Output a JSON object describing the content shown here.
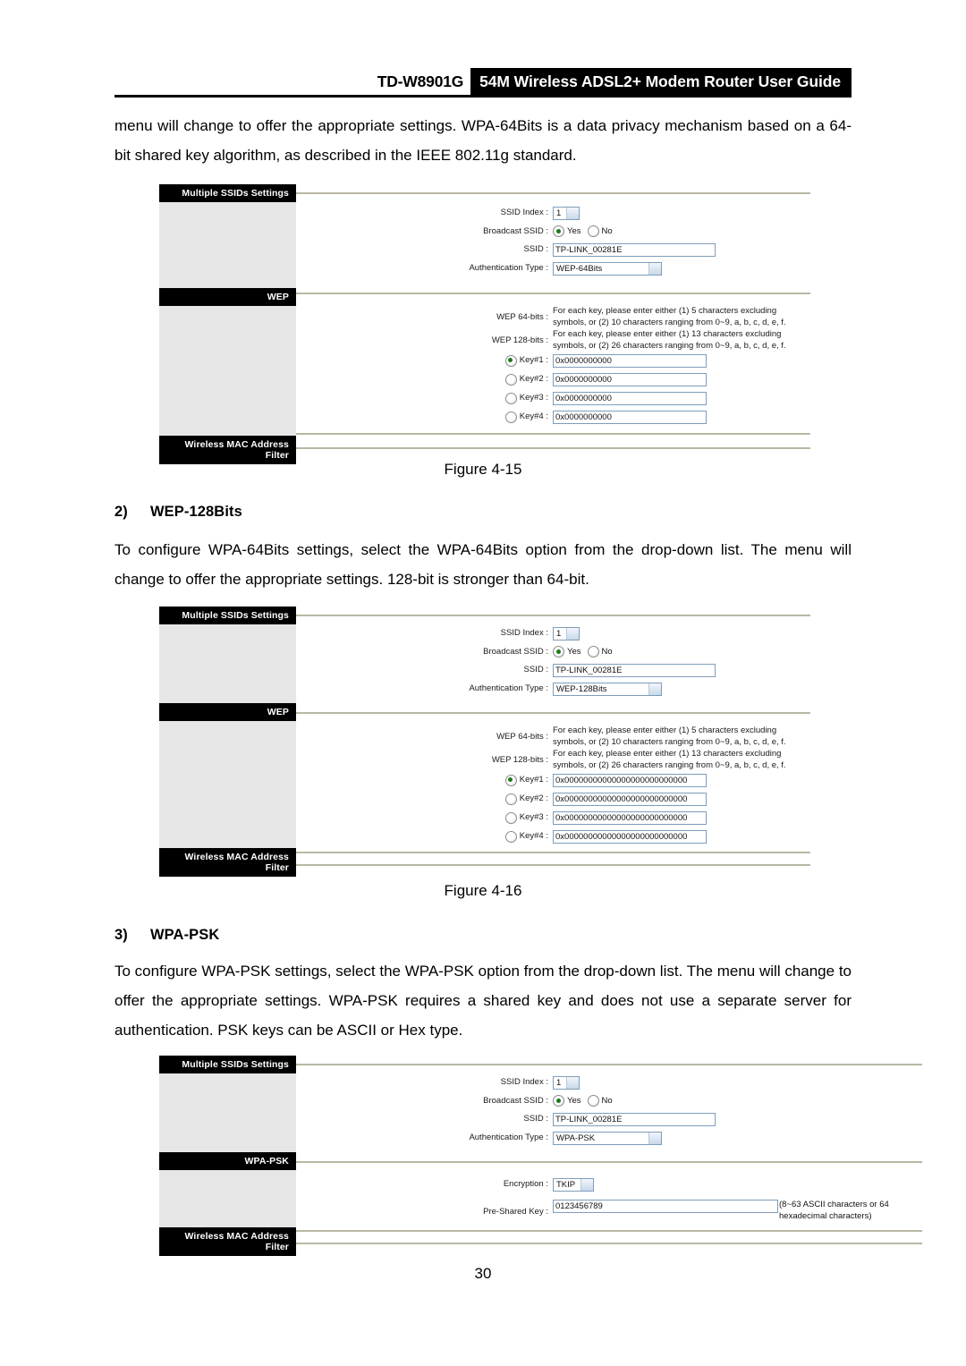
{
  "header": {
    "model": "TD-W8901G",
    "title": "54M Wireless ADSL2+ Modem Router User Guide"
  },
  "body": {
    "intro_paragraph": "menu will change to offer the appropriate settings. WPA-64Bits is a data privacy mechanism based on a 64-bit shared key algorithm, as described in the IEEE 802.11g standard.",
    "figure_4_15_caption": "Figure 4-15",
    "section2": {
      "number": "2)",
      "title": "WEP-128Bits",
      "paragraph": "To configure WPA-64Bits settings, select the WPA-64Bits option from the drop-down list. The menu will change to offer the appropriate settings. 128-bit is stronger than 64-bit."
    },
    "figure_4_16_caption": "Figure 4-16",
    "section3": {
      "number": "3)",
      "title": "WPA-PSK",
      "paragraph": "To configure WPA-PSK settings, select the WPA-PSK option from the drop-down list. The menu will change to offer the appropriate settings. WPA-PSK requires a shared key and does not use a separate server for authentication. PSK keys can be ASCII or Hex type."
    },
    "page_number": "30"
  },
  "shared": {
    "tabs": {
      "multiple_ssids": "Multiple SSIDs Settings",
      "wep": "WEP",
      "wpa_psk": "WPA-PSK",
      "wireless_mac_line1": "Wireless MAC Address",
      "wireless_mac_line2": "Filter"
    },
    "labels": {
      "ssid_index": "SSID Index :",
      "broadcast_ssid": "Broadcast SSID :",
      "ssid": "SSID :",
      "auth_type": "Authentication Type :",
      "wep_64": "WEP 64-bits :",
      "wep_128": "WEP 128-bits :",
      "key1": "Key#1 :",
      "key2": "Key#2 :",
      "key3": "Key#3 :",
      "key4": "Key#4 :",
      "encryption": "Encryption :",
      "pre_shared_key": "Pre-Shared Key :"
    },
    "radio_yes": "Yes",
    "radio_no": "No",
    "hints": {
      "wep_64_hint": "For each key, please enter either (1) 5 characters excluding symbols, or (2) 10 characters ranging from 0~9, a, b, c, d, e, f.",
      "wep_128_hint": "For each key, please enter either (1) 13 characters excluding symbols, or (2) 26 characters ranging from 0~9, a, b, c, d, e, f."
    }
  },
  "figure1": {
    "ssid_index_value": "1",
    "ssid_value": "TP-LINK_00281E",
    "auth_type_value": "WEP-64Bits",
    "keys": [
      "0x0000000000",
      "0x0000000000",
      "0x0000000000",
      "0x0000000000"
    ],
    "selected_key": 0
  },
  "figure2": {
    "ssid_index_value": "1",
    "ssid_value": "TP-LINK_00281E",
    "auth_type_value": "WEP-128Bits",
    "keys": [
      "0x00000000000000000000000000",
      "0x00000000000000000000000000",
      "0x00000000000000000000000000",
      "0x00000000000000000000000000"
    ],
    "selected_key": 0
  },
  "figure3": {
    "ssid_index_value": "1",
    "ssid_value": "TP-LINK_00281E",
    "auth_type_value": "WPA-PSK",
    "encryption_value": "TKIP",
    "pre_shared_key_value": "0123456789",
    "psk_note": "(8~63 ASCII characters or 64 hexadecimal characters)"
  },
  "colors": {
    "header_bar": "#000000",
    "sidebar_tab_bg": "#000000",
    "sidebar_body_bg": "#e6e6e6",
    "rule": "#b9b7a4",
    "input_border": "#7f9db9",
    "radio_dot": "#1b7a1b"
  }
}
